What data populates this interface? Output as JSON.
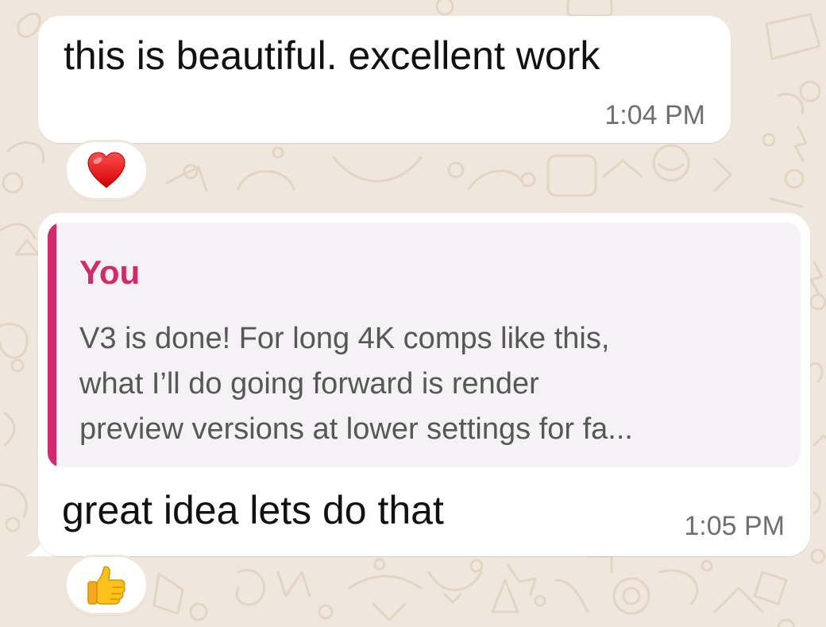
{
  "messages": [
    {
      "text": "this is beautiful. excellent work",
      "time": "1:04 PM",
      "reaction": "red-heart"
    },
    {
      "quoted": {
        "author": "You",
        "lines": [
          "V3 is done! For long 4K comps like this,",
          "what I’ll do going forward is render",
          "preview versions at lower settings for fa..."
        ]
      },
      "text": "great idea lets do that",
      "time": "1:05 PM",
      "reaction": "thumbs-up"
    }
  ],
  "colors": {
    "background": "#efe7dc",
    "bubble": "#ffffff",
    "quote_accent": "#d42a6b",
    "quote_background": "#f4f2f4",
    "timestamp": "#6f6f6f"
  }
}
